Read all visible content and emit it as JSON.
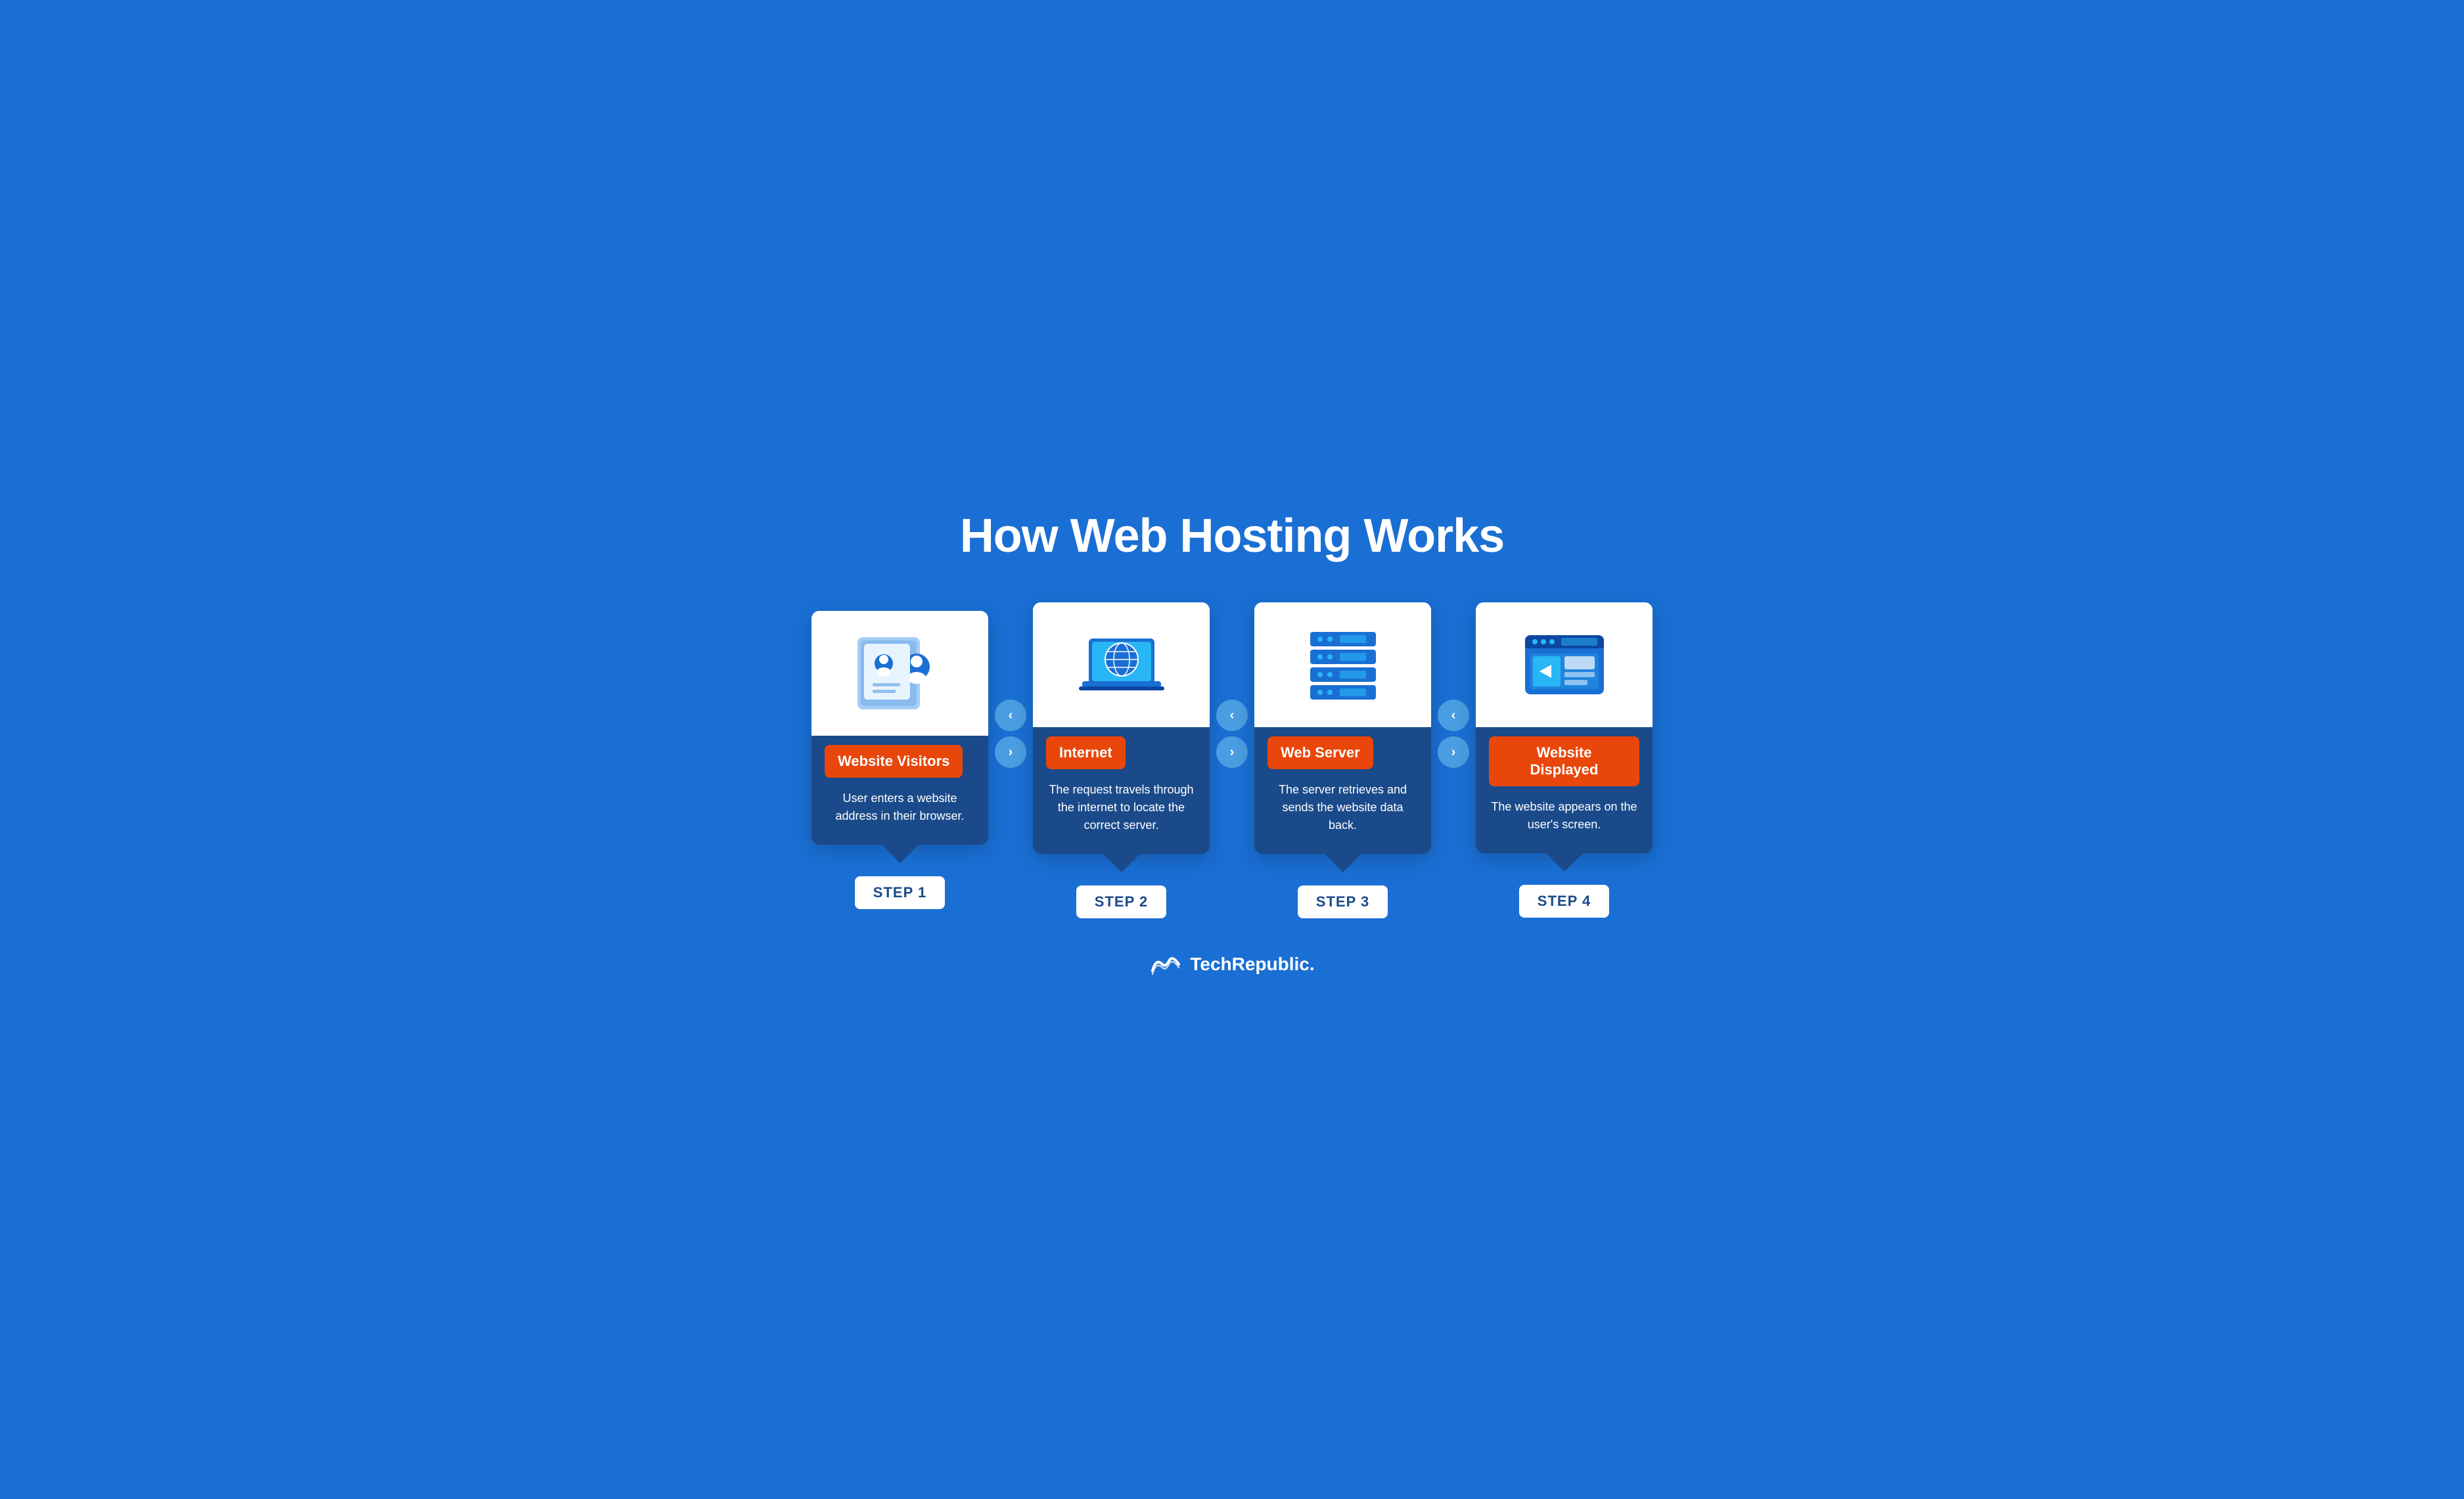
{
  "page": {
    "title": "How Web Hosting Works",
    "background_color": "#1a6fd4",
    "brand": {
      "name": "TechRepublic",
      "logo_text": "TechRepublic."
    }
  },
  "steps": [
    {
      "id": 1,
      "label": "Website Visitors",
      "description": "User enters a website address in their browser.",
      "step_text": "STEP 1",
      "icon": "visitors"
    },
    {
      "id": 2,
      "label": "Internet",
      "description": "The request travels through the internet to locate the correct server.",
      "step_text": "STEP 2",
      "icon": "internet"
    },
    {
      "id": 3,
      "label": "Web Server",
      "description": "The server retrieves and sends the website data back.",
      "step_text": "STEP 3",
      "icon": "server"
    },
    {
      "id": 4,
      "label": "Website Displayed",
      "description": "The website appears on the user's screen.",
      "step_text": "STEP 4",
      "icon": "display"
    }
  ],
  "arrows": [
    {
      "up": "<",
      "down": ">"
    },
    {
      "up": "<",
      "down": ">"
    },
    {
      "up": "<",
      "down": ">"
    }
  ]
}
